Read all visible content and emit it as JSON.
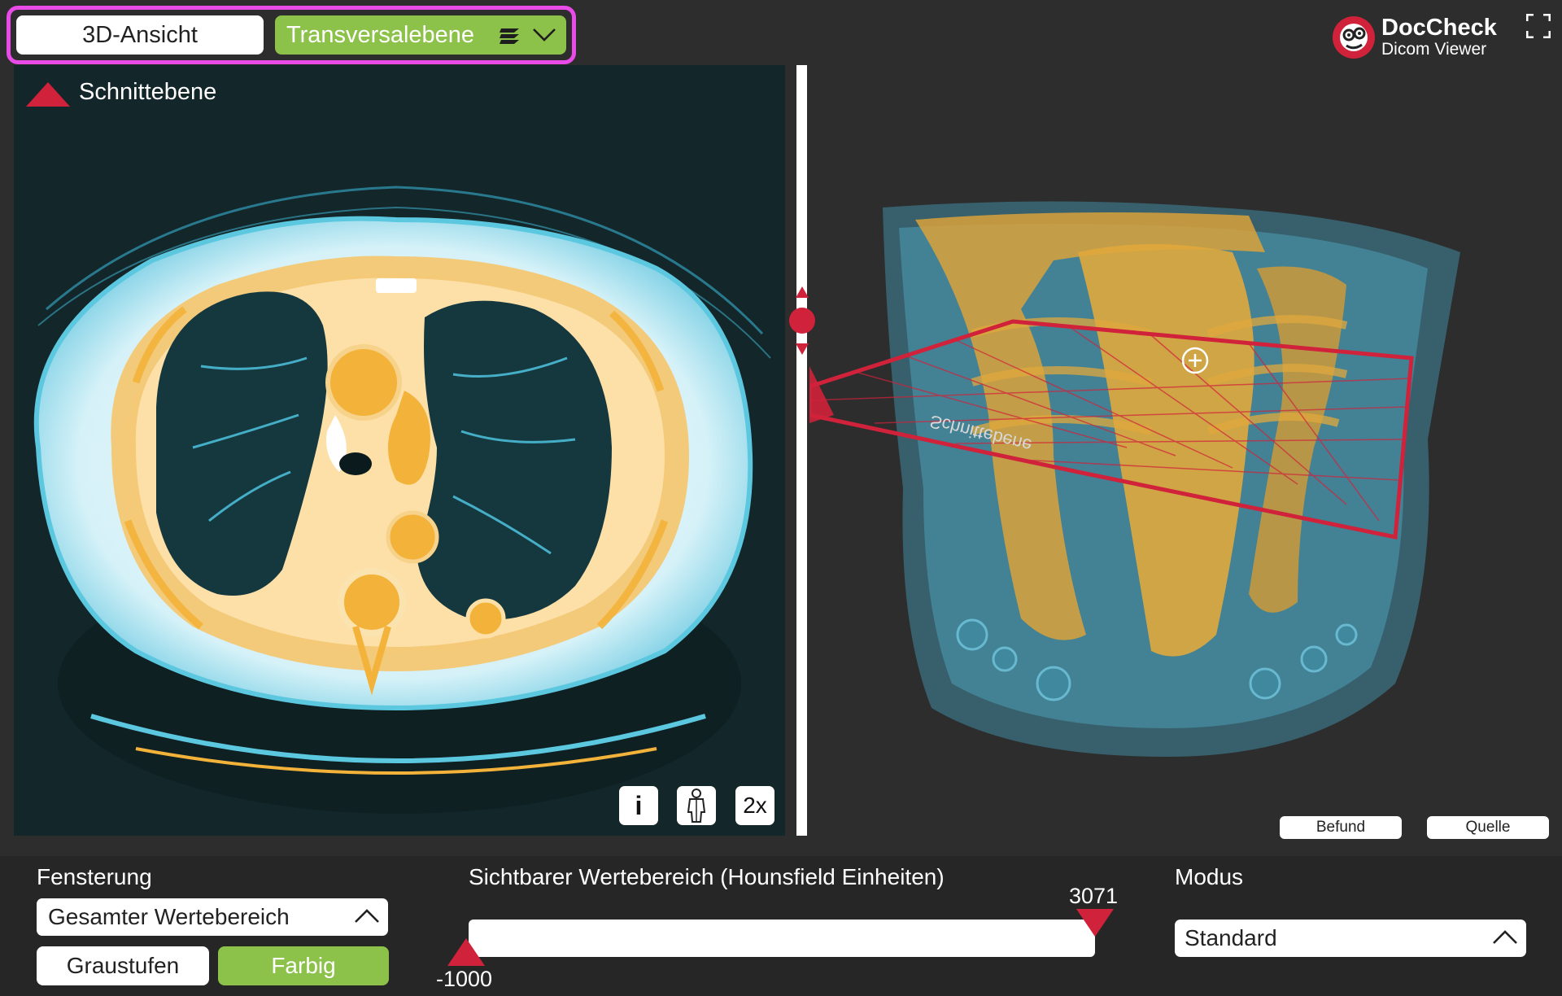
{
  "header": {
    "tab_3d_label": "3D-Ansicht",
    "tab_plane_label": "Transversalebene",
    "logo_title": "DocCheck",
    "logo_subtitle": "Dicom Viewer"
  },
  "slice_view": {
    "plane_label": "Schnittebene",
    "info_label": "i",
    "zoom_label": "2x",
    "reversed_plane_label": "Schnittebene"
  },
  "volume_view": {
    "befund_label": "Befund",
    "quelle_label": "Quelle"
  },
  "windowing": {
    "label": "Fensterung",
    "selected": "Gesamter Wertebereich",
    "gray_label": "Graustufen",
    "color_label": "Farbig"
  },
  "range": {
    "label": "Sichtbarer Wertebereich (Hounsfield Einheiten)",
    "min": "-1000",
    "max": "3071"
  },
  "mode": {
    "label": "Modus",
    "selected": "Standard"
  },
  "colors": {
    "accent_green": "#8cc24a",
    "highlight_pink": "#e94be8",
    "marker_red": "#d0223a",
    "bone_orange": "#f4b73d",
    "tissue_cyan": "#56c3dd"
  }
}
